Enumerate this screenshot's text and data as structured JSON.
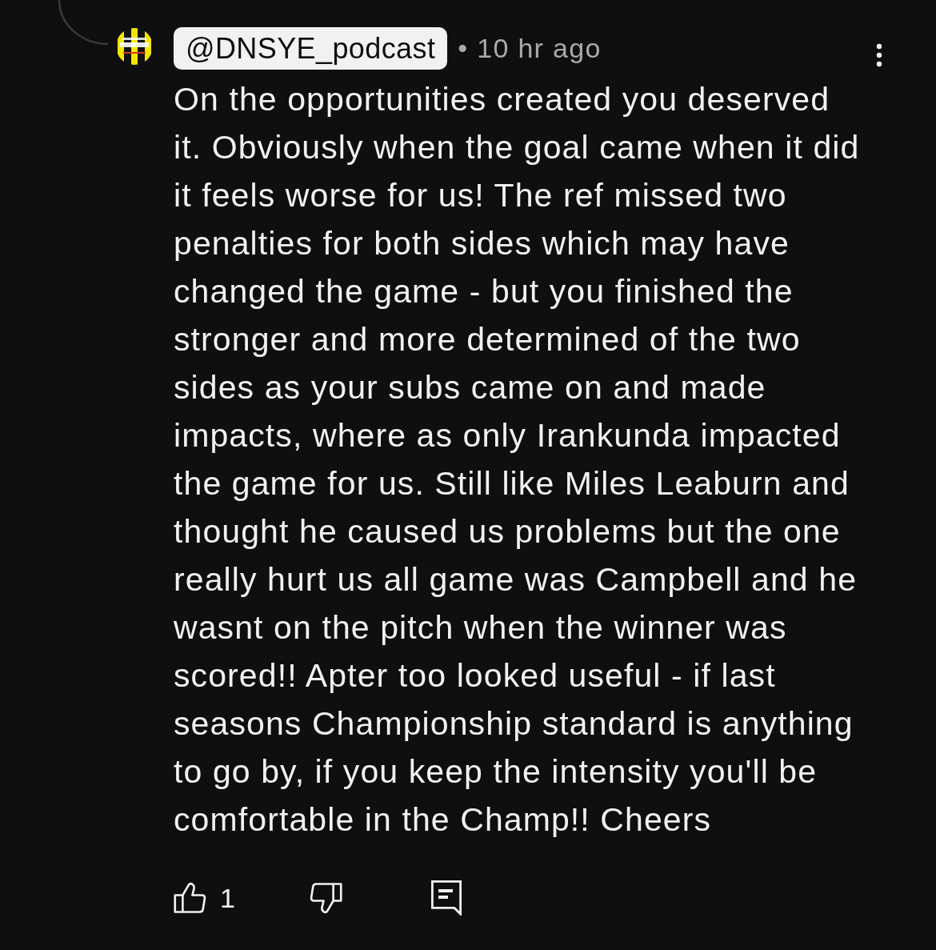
{
  "comment": {
    "author": "@DNSYE_podcast",
    "author_highlighted": true,
    "time": "• 10 hr ago",
    "body_lines": [
      "On the opportunities created you deserved",
      "it. Obviously when the goal came when it did",
      "it feels worse for us! The ref missed two",
      "penalties for both sides which may have",
      "changed the game - but you finished the",
      "stronger and more determined of the two",
      "sides as your subs came on and made",
      "impacts, where as only Irankunda impacted",
      "the game for us. Still like Miles Leaburn and",
      "thought he caused us problems but the one",
      "really hurt us all game was Campbell and he",
      "wasnt on the pitch when the winner was",
      "scored!! Apter too looked useful - if last",
      "seasons Championship standard is anything",
      "to go by, if you keep the intensity you'll be",
      "comfortable in the Champ!! Cheers"
    ],
    "like_count": "1"
  }
}
